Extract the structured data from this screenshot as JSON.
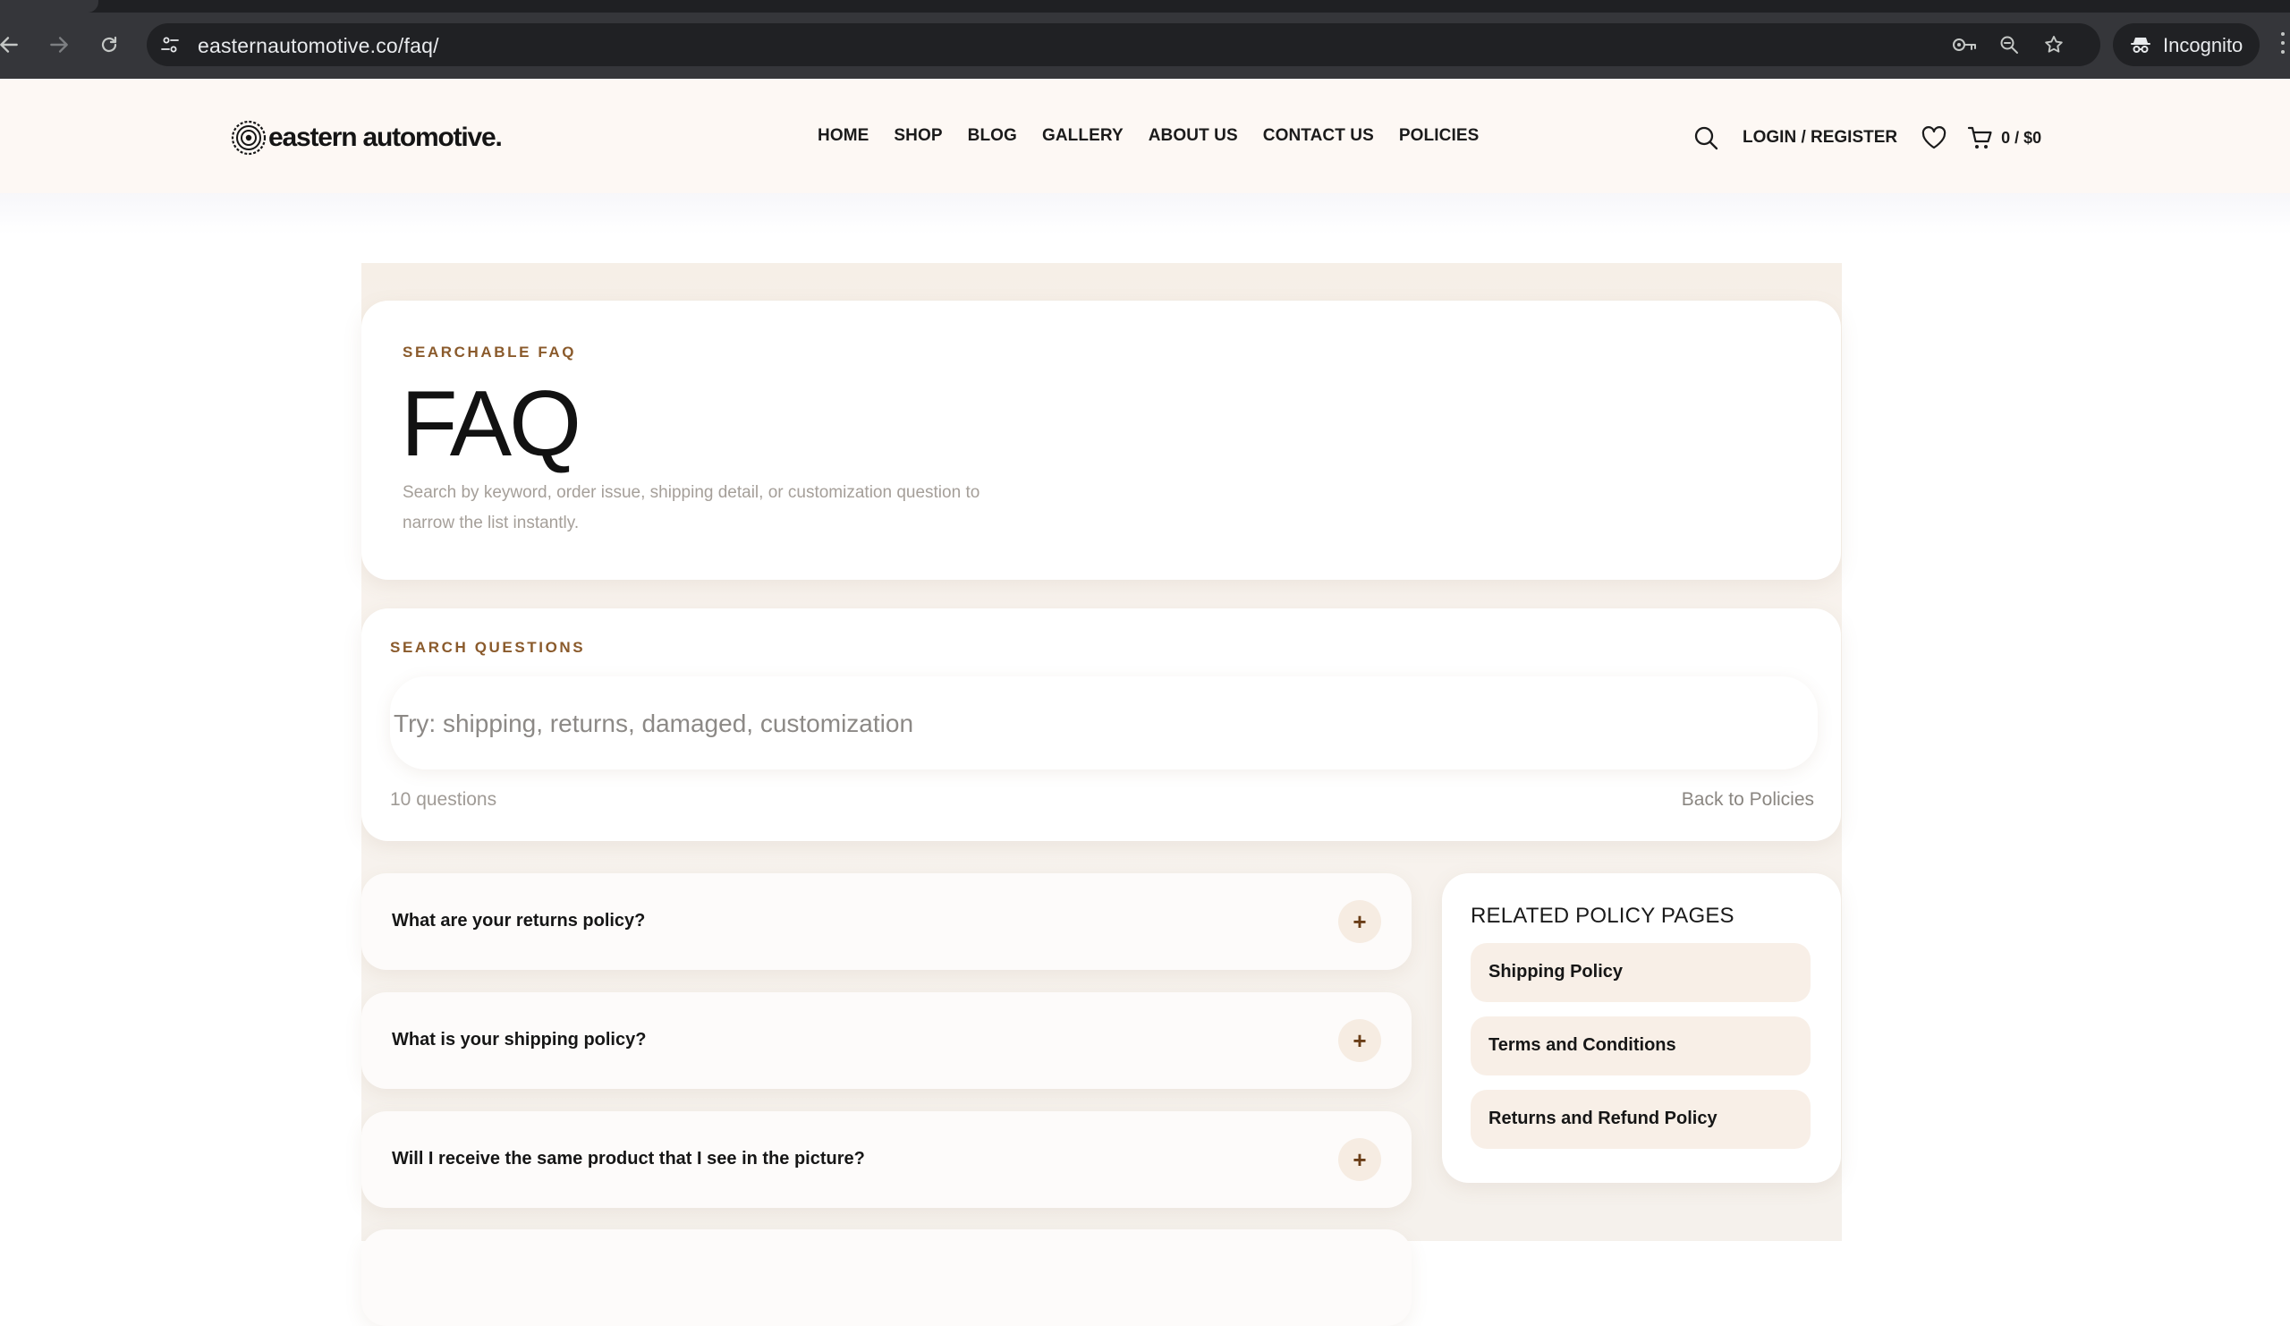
{
  "browser": {
    "url": "easternautomotive.co/faq/",
    "incognito_label": "Incognito"
  },
  "site": {
    "logo_text": "eastern automotive.",
    "nav": [
      "HOME",
      "SHOP",
      "BLOG",
      "GALLERY",
      "ABOUT US",
      "CONTACT US",
      "POLICIES"
    ],
    "login_label": "LOGIN / REGISTER",
    "cart_total": "0 / $0"
  },
  "hero": {
    "eyebrow": "SEARCHABLE FAQ",
    "title": "FAQ",
    "subtitle": "Search by keyword, order issue, shipping detail, or customization question to narrow the list instantly."
  },
  "search": {
    "eyebrow": "SEARCH QUESTIONS",
    "placeholder": "Try: shipping, returns, damaged, customization",
    "count": "10 questions",
    "back_link": "Back to Policies"
  },
  "faqs": [
    {
      "question": "What are your returns policy?",
      "toggle": "+"
    },
    {
      "question": "What is your shipping policy?",
      "toggle": "+"
    },
    {
      "question": "Will I receive the same product that I see in the picture?",
      "toggle": "+"
    }
  ],
  "related": {
    "title": "RELATED POLICY PAGES",
    "links": [
      "Shipping Policy",
      "Terms and Conditions",
      "Returns and Refund Policy"
    ]
  },
  "colors": {
    "accent": "#8a5a2b",
    "header_bg": "#fdf8f4",
    "panel_bg": "#f6efe7",
    "chip_bg": "#f8efe7",
    "chrome_bg": "#35363a"
  },
  "icons": [
    "back-arrow-icon",
    "forward-arrow-icon",
    "reload-icon",
    "site-settings-icon",
    "key-icon",
    "zoom-icon",
    "bookmark-star-icon",
    "incognito-icon",
    "search-icon",
    "heart-icon",
    "cart-icon",
    "plus-icon"
  ]
}
